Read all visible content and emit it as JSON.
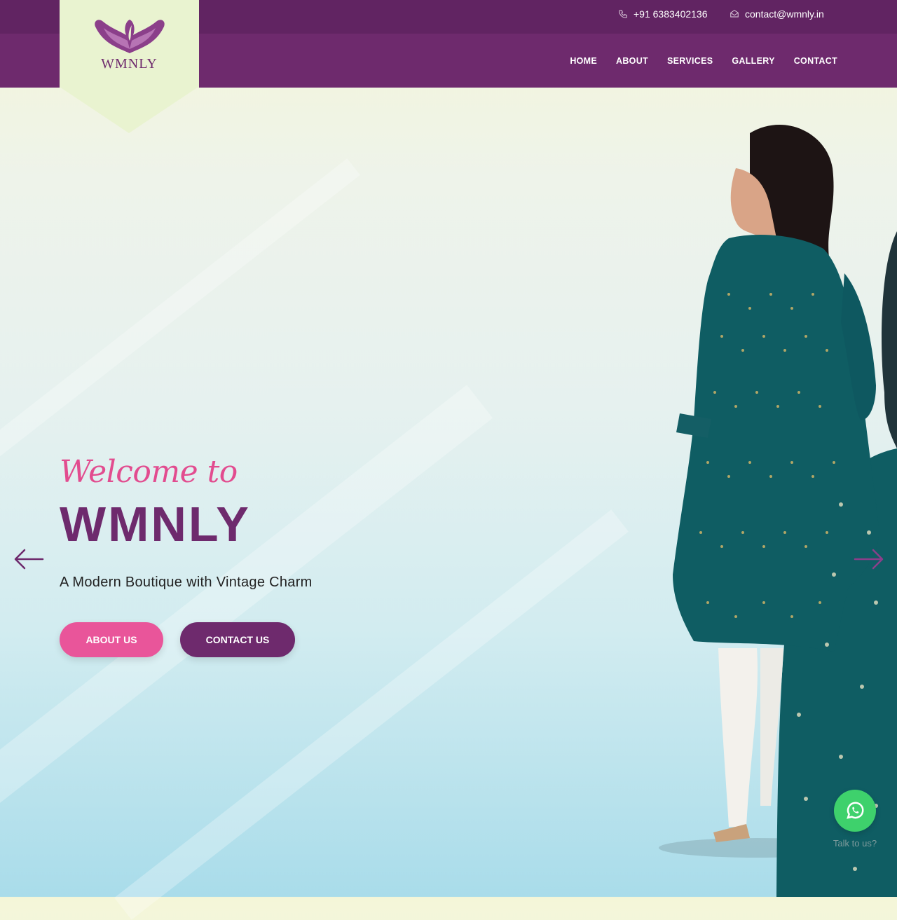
{
  "header": {
    "phone": "+91 6383402136",
    "email": "contact@wmnly.in",
    "logo_text": "WMNLY"
  },
  "nav": {
    "items": [
      "HOME",
      "ABOUT",
      "SERVICES",
      "GALLERY",
      "CONTACT"
    ]
  },
  "hero": {
    "welcome": "Welcome to",
    "brand": "WMNLY",
    "tagline": "A Modern Boutique with Vintage Charm",
    "about_button": "ABOUT US",
    "contact_button": "CONTACT US"
  },
  "whatsapp": {
    "label": "Talk to us?"
  },
  "colors": {
    "brand_purple": "#6e2a6d",
    "topbar_purple": "#612462",
    "accent_pink": "#e9559a",
    "logo_bg": "#e9f3d0",
    "whatsapp_green": "#3ed16c",
    "dress_teal": "#0f5d63"
  },
  "icons": [
    "phone-icon",
    "mail-icon",
    "wings-logo-icon",
    "arrow-left-icon",
    "arrow-right-icon",
    "whatsapp-icon"
  ]
}
